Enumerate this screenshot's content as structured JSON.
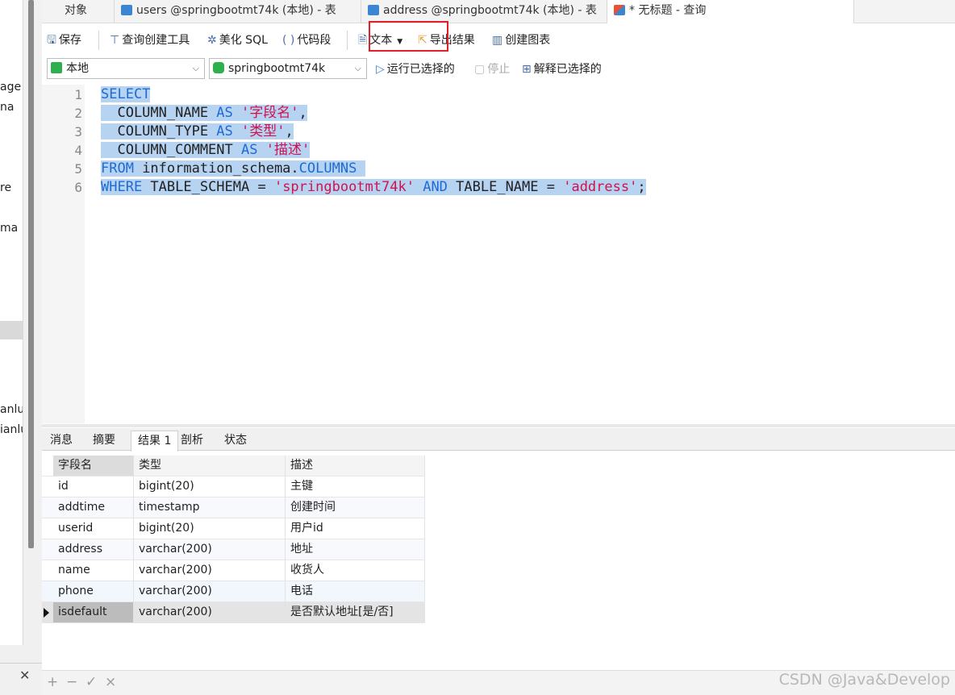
{
  "sidebar": {
    "fragments": [
      "age",
      "na",
      "re",
      "ma",
      "anlu",
      "ianlu"
    ]
  },
  "tabs": [
    {
      "label": "对象"
    },
    {
      "label": "users @springbootmt74k (本地) - 表"
    },
    {
      "label": "address @springbootmt74k (本地) - 表"
    },
    {
      "label": "* 无标题 - 查询"
    }
  ],
  "toolbar": {
    "save": "保存",
    "query_builder": "查询创建工具",
    "beautify": "美化 SQL",
    "snippet": "代码段",
    "text": "文本",
    "export": "导出结果",
    "create_chart": "创建图表"
  },
  "connection": {
    "server": "本地",
    "database": "springbootmt74k",
    "run_selected": "运行已选择的",
    "stop": "停止",
    "explain_selected": "解释已选择的"
  },
  "editor": {
    "line_numbers": [
      "1",
      "2",
      "3",
      "4",
      "5",
      "6"
    ],
    "l1": {
      "kw": "SELECT"
    },
    "l2": {
      "a": "  COLUMN_NAME ",
      "kw": "AS",
      "sp": " ",
      "str": "'字段名'",
      "end": ","
    },
    "l3": {
      "a": "  COLUMN_TYPE ",
      "kw": "AS",
      "sp": " ",
      "str": "'类型'",
      "end": ","
    },
    "l4": {
      "a": "  COLUMN_COMMENT ",
      "kw": "AS",
      "sp": " ",
      "str": "'描述'"
    },
    "l5": {
      "kw": "FROM",
      "a": " information_schema.",
      "kw2": "COLUMNS",
      "end": " "
    },
    "l6": {
      "kw": "WHERE",
      "a": " TABLE_SCHEMA = ",
      "str": "'springbootmt74k'",
      "sp": " ",
      "kw2": "AND",
      "b": " TABLE_NAME = ",
      "str2": "'address'",
      "end": ";"
    }
  },
  "result_tabs": [
    {
      "label": "消息"
    },
    {
      "label": "摘要"
    },
    {
      "label": "结果 1"
    },
    {
      "label": "剖析"
    },
    {
      "label": "状态"
    }
  ],
  "grid": {
    "headers": [
      "字段名",
      "类型",
      "描述"
    ],
    "rows": [
      [
        "id",
        "bigint(20)",
        "主键"
      ],
      [
        "addtime",
        "timestamp",
        "创建时间"
      ],
      [
        "userid",
        "bigint(20)",
        "用户id"
      ],
      [
        "address",
        "varchar(200)",
        "地址"
      ],
      [
        "name",
        "varchar(200)",
        "收货人"
      ],
      [
        "phone",
        "varchar(200)",
        "电话"
      ],
      [
        "isdefault",
        "varchar(200)",
        "是否默认地址[是/否]"
      ]
    ]
  },
  "bottom": {
    "add": "+",
    "remove": "−",
    "apply": "✓",
    "discard": "×"
  },
  "watermark": "CSDN @Java&Develop",
  "colors": {
    "selection": "#b7d3f2",
    "keyword": "#1e6bd6",
    "string": "#d0124d",
    "highlight_box": "#e0202a"
  }
}
